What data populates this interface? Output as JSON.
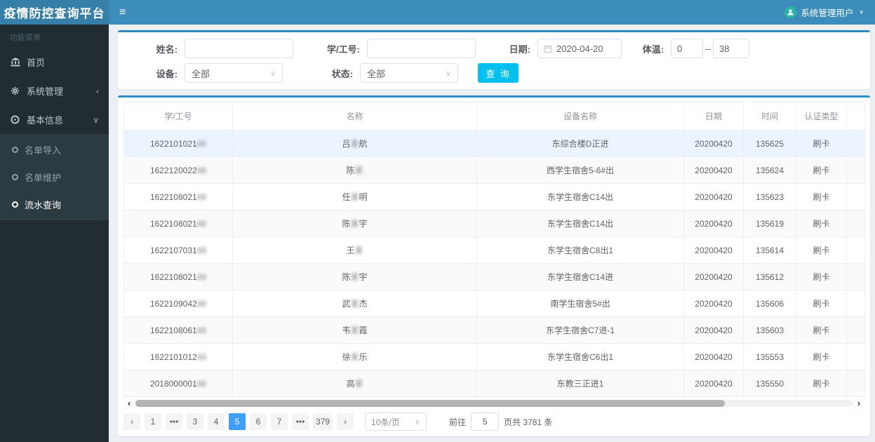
{
  "header": {
    "app_title": "疫情防控查询平台",
    "hamburger_glyph": "≡",
    "user_name": "系统管理用户",
    "user_caret": "∨"
  },
  "sidebar": {
    "section_label": "功能菜单",
    "items": [
      {
        "label": "首页",
        "icon": "bank-icon",
        "caret": ""
      },
      {
        "label": "系统管理",
        "icon": "gear-icon",
        "caret": "‹"
      },
      {
        "label": "基本信息",
        "icon": "circle-dot-icon",
        "caret": "∨"
      }
    ],
    "submenu": [
      {
        "label": "名单导入",
        "active": false
      },
      {
        "label": "名单维护",
        "active": false
      },
      {
        "label": "流水查询",
        "active": true
      }
    ]
  },
  "form": {
    "name_label": "姓名:",
    "id_label": "学/工号:",
    "date_label": "日期:",
    "date_value": "2020-04-20",
    "temp_label": "体温:",
    "temp_min": "0",
    "temp_sep": "--",
    "temp_max": "38",
    "device_label": "设备:",
    "device_value": "全部",
    "status_label": "状态:",
    "status_value": "全部",
    "select_caret": "∨",
    "search_button": "查 询"
  },
  "table": {
    "columns": [
      "学/工号",
      "名称",
      "设备名称",
      "日期",
      "时间",
      "认证类型",
      ""
    ],
    "rows": [
      {
        "id": "1622101021",
        "id_blur": "88",
        "name_pre": "吕",
        "name_blur": "某",
        "name_suf": "航",
        "device": "东综合楼D正进",
        "date": "20200420",
        "time": "135625",
        "auth": "刷卡"
      },
      {
        "id": "1622120022",
        "id_blur": "88",
        "name_pre": "陈",
        "name_blur": "某",
        "name_suf": "",
        "device": "西学生宿舍5-6#出",
        "date": "20200420",
        "time": "135624",
        "auth": "刷卡"
      },
      {
        "id": "1622108021",
        "id_blur": "88",
        "name_pre": "任",
        "name_blur": "某",
        "name_suf": "明",
        "device": "东学生宿舍C14出",
        "date": "20200420",
        "time": "135623",
        "auth": "刷卡"
      },
      {
        "id": "1622108021",
        "id_blur": "88",
        "name_pre": "陈",
        "name_blur": "某",
        "name_suf": "宇",
        "device": "东学生宿舍C14出",
        "date": "20200420",
        "time": "135619",
        "auth": "刷卡"
      },
      {
        "id": "1622107031",
        "id_blur": "88",
        "name_pre": "王",
        "name_blur": "某",
        "name_suf": "",
        "device": "东学生宿舍C8出1",
        "date": "20200420",
        "time": "135614",
        "auth": "刷卡"
      },
      {
        "id": "1622108021",
        "id_blur": "88",
        "name_pre": "陈",
        "name_blur": "某",
        "name_suf": "宇",
        "device": "东学生宿舍C14进",
        "date": "20200420",
        "time": "135612",
        "auth": "刷卡"
      },
      {
        "id": "1622109042",
        "id_blur": "88",
        "name_pre": "武",
        "name_blur": "某",
        "name_suf": "杰",
        "device": "南学生宿舍5#出",
        "date": "20200420",
        "time": "135606",
        "auth": "刷卡"
      },
      {
        "id": "1622108061",
        "id_blur": "88",
        "name_pre": "韦",
        "name_blur": "某",
        "name_suf": "霞",
        "device": "东学生宿舍C7进-1",
        "date": "20200420",
        "time": "135603",
        "auth": "刷卡"
      },
      {
        "id": "1622101012",
        "id_blur": "88",
        "name_pre": "徐",
        "name_blur": "某",
        "name_suf": "乐",
        "device": "东学生宿舍C6出1",
        "date": "20200420",
        "time": "135553",
        "auth": "刷卡"
      },
      {
        "id": "2018000001",
        "id_blur": "88",
        "name_pre": "高",
        "name_blur": "某",
        "name_suf": "",
        "device": "东教三正进1",
        "date": "20200420",
        "time": "135550",
        "auth": "刷卡"
      }
    ]
  },
  "scrollbar": {
    "left_arrow": "‹",
    "right_arrow": "›"
  },
  "pagination": {
    "prev": "‹",
    "next": "›",
    "pages": [
      "1",
      "•••",
      "3",
      "4",
      "5",
      "6",
      "7",
      "•••",
      "379"
    ],
    "active_index": 4,
    "page_size": "10条/页",
    "size_caret": "∨",
    "goto_label": "前往",
    "goto_value": "5",
    "total_text": "页共 3781 条"
  },
  "colors": {
    "navbar": "#3c8dbc",
    "logo_bg": "#367fa9",
    "sidebar_bg": "#222d32",
    "submenu_bg": "#2c3b41",
    "box_top_border": "#2d8cc0",
    "search_button_bg": "#00c0ef",
    "pager_active": "#409eff",
    "selected_row_bg": "#ecf5ff",
    "avatar_bg": "#2cb5a3"
  }
}
